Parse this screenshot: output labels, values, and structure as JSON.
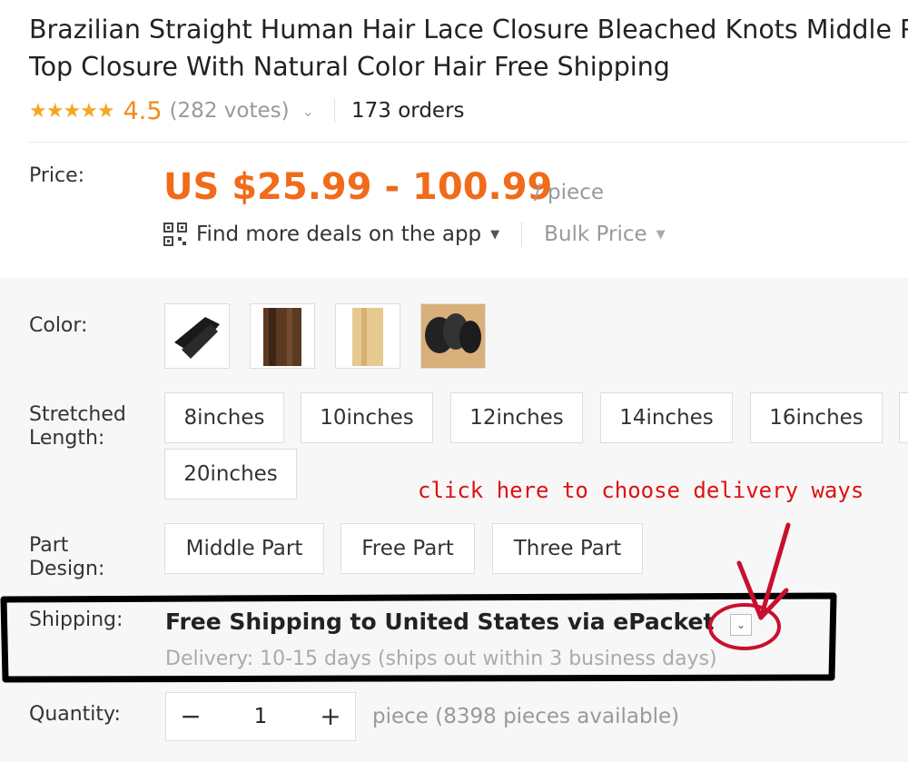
{
  "product": {
    "title_line1": "Brazilian Straight Human Hair Lace Closure Bleached Knots Middle Pa",
    "title_line2": "Top Closure With Natural Color Hair Free Shipping",
    "stars": "★★★★★",
    "rating": "4.5",
    "votes": "(282 votes)",
    "orders": "173 orders"
  },
  "price": {
    "label": "Price:",
    "value": "US $25.99 - 100.99",
    "unit": "/ piece",
    "app_deals": "Find more deals on the app",
    "bulk_price": "Bulk Price"
  },
  "color": {
    "label": "Color:",
    "thumbnails": [
      "black hair bundle",
      "brown straight hair",
      "blonde straight hair",
      "dark wavy closure"
    ]
  },
  "length": {
    "label_line1": "Stretched",
    "label_line2": "Length:",
    "options": [
      "8inches",
      "10inches",
      "12inches",
      "14inches",
      "16inches",
      "20inches"
    ]
  },
  "part": {
    "label_line1": "Part",
    "label_line2": "Design:",
    "options": [
      "Middle Part",
      "Free Part",
      "Three Part"
    ]
  },
  "annotation": {
    "text": "click here to choose delivery ways",
    "color": "#dd1111"
  },
  "shipping": {
    "label": "Shipping:",
    "method": "Free Shipping to United States via ePacket",
    "delivery": "Delivery: 10-15 days (ships out within 3 business days)"
  },
  "quantity": {
    "label": "Quantity:",
    "minus": "−",
    "value": "1",
    "plus": "+",
    "available": "piece (8398 pieces available)"
  },
  "colors": {
    "price": "#f06b1a",
    "star": "#f5a623",
    "annotation": "#dd1111"
  }
}
